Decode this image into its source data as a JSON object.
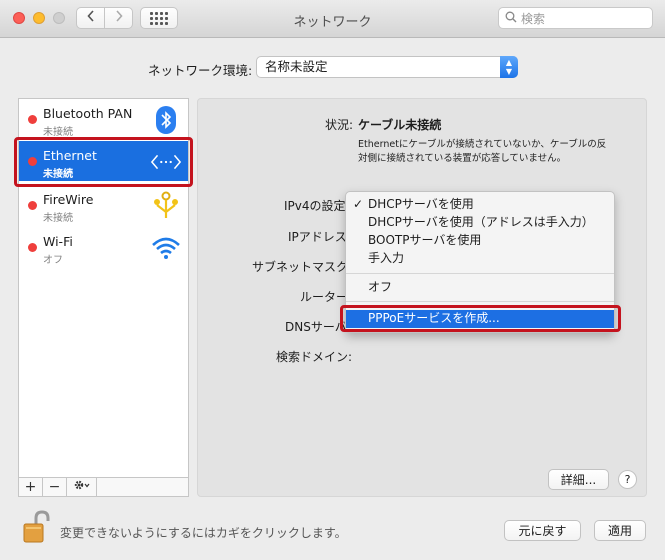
{
  "window": {
    "title": "ネットワーク"
  },
  "search": {
    "placeholder": "検索"
  },
  "location": {
    "label": "ネットワーク環境:",
    "value": "名称未設定"
  },
  "services": [
    {
      "name": "Bluetooth PAN",
      "status": "未接続",
      "icon": "bluetooth-icon",
      "status_color": "#ef3f3c"
    },
    {
      "name": "Ethernet",
      "status": "未接続",
      "icon": "ethernet-arrows-icon",
      "status_color": "#ef3f3c",
      "selected": true
    },
    {
      "name": "FireWire",
      "status": "未接続",
      "icon": "firewire-icon",
      "status_color": "#ef3f3c"
    },
    {
      "name": "Wi-Fi",
      "status": "オフ",
      "icon": "wifi-icon",
      "status_color": "#ef3f3c"
    }
  ],
  "sidebar_toolbar": {
    "add": "+",
    "remove": "−"
  },
  "detail": {
    "status_label": "状況:",
    "status_value": "ケーブル未接続",
    "status_description": "Ethernetにケーブルが接続されていないか、ケーブルの反対側に接続されている装置が応答していません。",
    "labels": {
      "ipv4": "IPv4の設定",
      "ip": "IPアドレス",
      "subnet": "サブネットマスク",
      "router": "ルーター",
      "dns": "DNSサーバ",
      "search_domain": "検索ドメイン:"
    }
  },
  "ipv4_menu": {
    "check": "✓",
    "items": [
      "DHCPサーバを使用",
      "DHCPサーバを使用（アドレスは手入力）",
      "BOOTPサーバを使用",
      "手入力",
      "オフ",
      "PPPoEサービスを作成..."
    ],
    "checked_index": 0,
    "highlighted_index": 5
  },
  "buttons": {
    "advanced": "詳細...",
    "help": "?",
    "revert": "元に戻す",
    "apply": "適用"
  },
  "lock": {
    "message": "変更できないようにするにはカギをクリックします。"
  },
  "colors": {
    "accent": "#1a6fe0",
    "status_red": "#ef3f3c",
    "annotation_red": "#c4131e",
    "bluetooth_blue": "#2b7ff0",
    "firewire_yellow": "#f2c318"
  }
}
